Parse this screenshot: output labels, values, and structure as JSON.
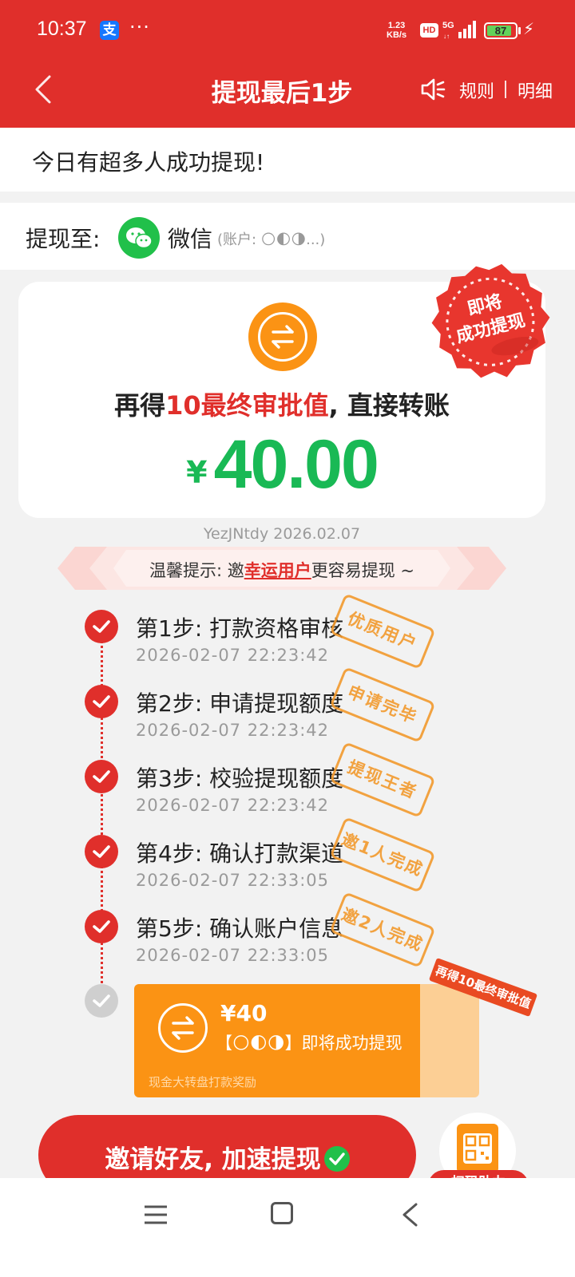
{
  "status_bar": {
    "time": "10:37",
    "app_icon": "alipay-icon",
    "app_icon_glyph": "支",
    "more_dots": "···",
    "net_speed_top": "1.23",
    "net_speed_bottom": "KB/s",
    "hd": "HD",
    "signal": "5G",
    "battery": "87",
    "charging_glyph": "⚡"
  },
  "header": {
    "title": "提现最后1步",
    "rules": "规则",
    "detail": "明细",
    "accent": "#e02f2b"
  },
  "notice": "今日有超多人成功提现!",
  "account": {
    "label": "提现至:",
    "channel": "微信",
    "info": "(账户: 🌕🌓🌗...)"
  },
  "card": {
    "headline_prefix": "再得",
    "headline_highlight": "10最终审批值",
    "headline_suffix": ", 直接转账",
    "currency": "¥",
    "amount": "40.00",
    "amount_color": "#19b955",
    "seal_line1": "即将",
    "seal_line2": "成功提现"
  },
  "ref_code": "YezJNtdy 2026.02.07",
  "tip": {
    "prefix": "温馨提示: 邀",
    "link": "幸运用户",
    "suffix": "更容易提现 ~"
  },
  "steps": [
    {
      "title": "第1步:  打款资格审核",
      "time": "2026-02-07 22:23:42",
      "stamp": "优质用户"
    },
    {
      "title": "第2步:  申请提现额度",
      "time": "2026-02-07 22:23:42",
      "stamp": "申请完毕"
    },
    {
      "title": "第3步:  校验提现额度",
      "time": "2026-02-07 22:23:42",
      "stamp": "提现王者"
    },
    {
      "title": "第4步:  确认打款渠道",
      "time": "2026-02-07 22:33:05",
      "stamp": "邀1人完成"
    },
    {
      "title": "第5步:  确认账户信息",
      "time": "2026-02-07 22:33:05",
      "stamp": "邀2人完成"
    }
  ],
  "reward": {
    "amount": "¥40",
    "desc": "【🌕🌓🌗】即将成功提现",
    "foot": "现金大转盘打款奖励",
    "ribbon": "再得10最终审批值"
  },
  "invite": {
    "label": "邀请好友, 加速提现"
  },
  "qr_fab": {
    "label": "扫码助力"
  }
}
